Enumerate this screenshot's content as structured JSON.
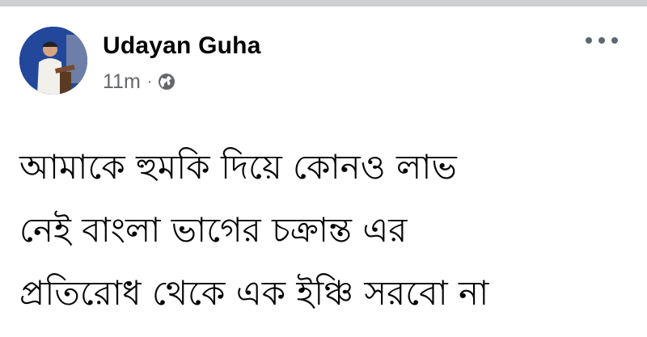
{
  "post": {
    "author": "Udayan Guha",
    "timestamp": "11m",
    "separator": "·",
    "privacy_icon": "globe-icon",
    "more_icon": "more-options-icon",
    "text_lines": [
      "আমাকে হুমকি দিয়ে কোনও লাভ",
      "নেই বাংলা ভাগের চক্রান্ত এর",
      "প্রতিরোধ থেকে এক ইঞ্চি সরবো না"
    ]
  },
  "colors": {
    "name": "#050505",
    "meta": "#65676b",
    "background": "#ffffff"
  }
}
